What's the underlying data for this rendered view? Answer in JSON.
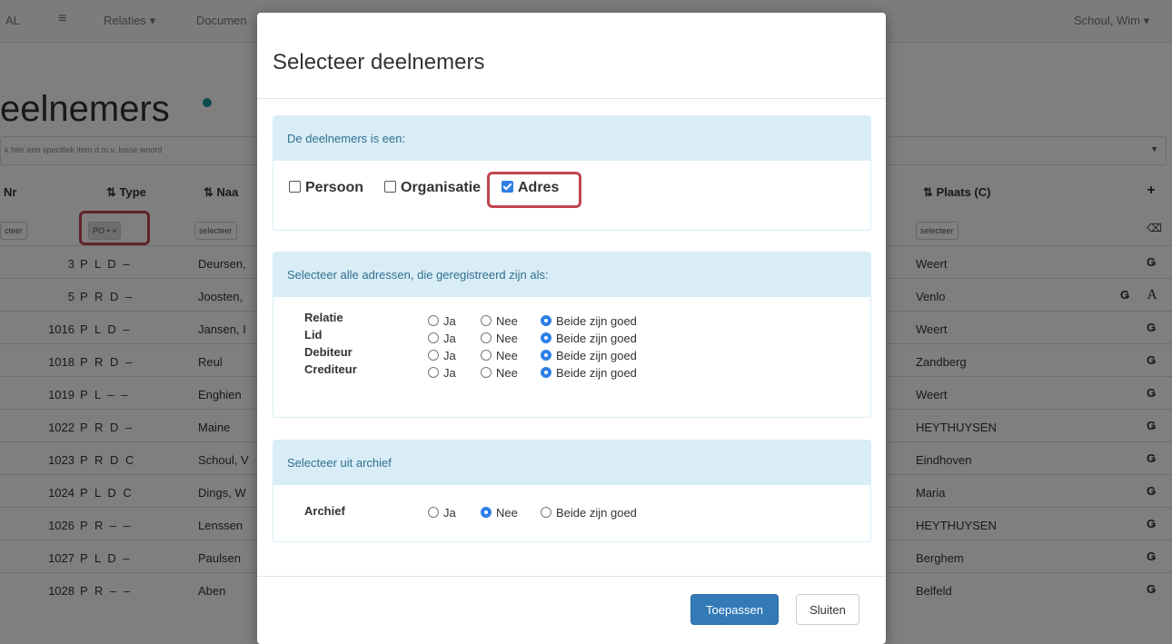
{
  "nav": {
    "logo": "AL",
    "menu_icon": "≡",
    "relaties": "Relaties ▾",
    "documenten": "Documen",
    "user": "Schoul, Wim ▾"
  },
  "page": {
    "title": "eelnemers",
    "search_placeholder": "k hier een specifiek item d.m.v. losse woord"
  },
  "table": {
    "headers": {
      "nr": "Nr",
      "type": "⇅ Type",
      "naam": "⇅ Naa",
      "plaats": "⇅ Plaats (C)"
    },
    "filters": {
      "nr": "cteer",
      "type": "PO • ×",
      "naam": "selecteer",
      "plaats": "selecteer"
    },
    "rows": [
      {
        "nr": "3",
        "type": "P L D –",
        "naam": "Deursen,",
        "plaats": "Weert"
      },
      {
        "nr": "5",
        "type": "P R D –",
        "naam": "Joosten,",
        "plaats": "Venlo"
      },
      {
        "nr": "1016",
        "type": "P L D –",
        "naam": "Jansen, I",
        "plaats": "Weert"
      },
      {
        "nr": "1018",
        "type": "P R D –",
        "naam": "Reul",
        "plaats": "Zandberg"
      },
      {
        "nr": "1019",
        "type": "P L – –",
        "naam": "Enghien",
        "plaats": "Weert"
      },
      {
        "nr": "1022",
        "type": "P R D –",
        "naam": "Maine",
        "plaats": "HEYTHUYSEN"
      },
      {
        "nr": "1023",
        "type": "P R D C",
        "naam": "Schoul, V",
        "plaats": "Eindhoven"
      },
      {
        "nr": "1024",
        "type": "P L D C",
        "naam": "Dings, W",
        "plaats": "Maria"
      },
      {
        "nr": "1026",
        "type": "P R – –",
        "naam": "Lenssen",
        "plaats": "HEYTHUYSEN"
      },
      {
        "nr": "1027",
        "type": "P L D –",
        "naam": "Paulsen",
        "plaats": "Berghem"
      },
      {
        "nr": "1028",
        "type": "P R – –",
        "naam": "Aben",
        "plaats": "Belfeld"
      }
    ],
    "edit_glyph": "Ǥ",
    "a_glyph": "A"
  },
  "modal": {
    "title": "Selecteer deelnemers",
    "panel1": {
      "heading": "De deelnemers is een:",
      "checkboxes": [
        {
          "label": "Persoon",
          "checked": false
        },
        {
          "label": "Organisatie",
          "checked": false
        },
        {
          "label": "Adres",
          "checked": true
        }
      ]
    },
    "panel2": {
      "heading": "Selecteer alle adressen, die geregistreerd zijn als:",
      "options": [
        "Ja",
        "Nee",
        "Beide zijn goed"
      ],
      "rows": [
        {
          "label": "Relatie",
          "selected": "Beide zijn goed"
        },
        {
          "label": "Lid",
          "selected": "Beide zijn goed"
        },
        {
          "label": "Debiteur",
          "selected": "Beide zijn goed"
        },
        {
          "label": "Crediteur",
          "selected": "Beide zijn goed"
        }
      ]
    },
    "panel3": {
      "heading": "Selecteer uit archief",
      "label": "Archief",
      "options": [
        "Ja",
        "Nee",
        "Beide zijn goed"
      ],
      "selected": "Nee"
    },
    "buttons": {
      "apply": "Toepassen",
      "close": "Sluiten"
    }
  },
  "colors": {
    "primary": "#337ab7",
    "panel_heading": "#d9edf7",
    "highlight": "#c0454f",
    "check": "#2d7fe6"
  }
}
